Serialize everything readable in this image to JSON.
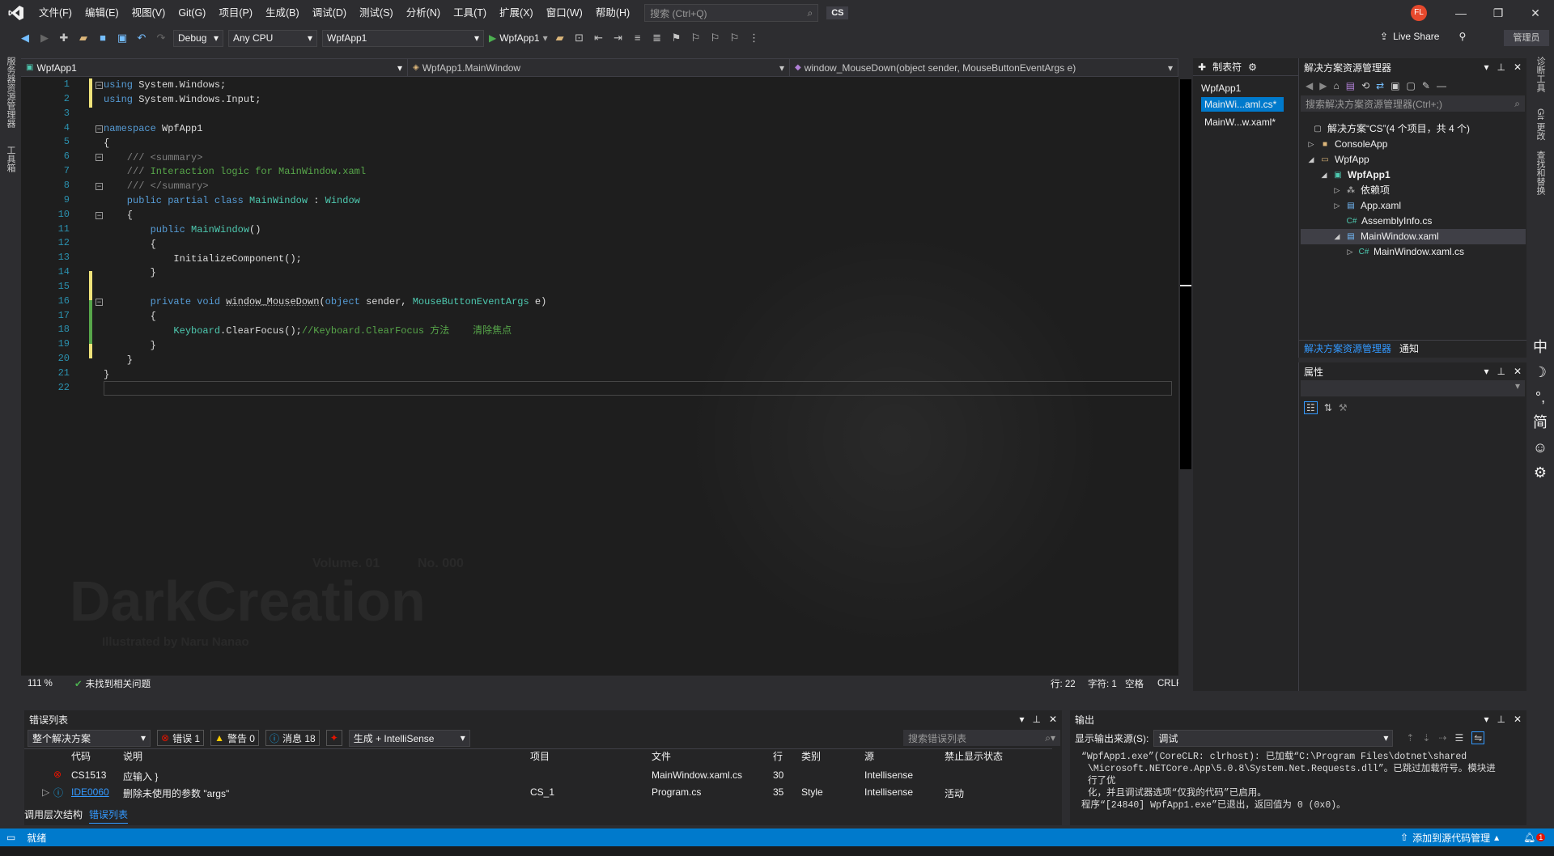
{
  "menu": {
    "items": [
      "文件(F)",
      "编辑(E)",
      "视图(V)",
      "Git(G)",
      "项目(P)",
      "生成(B)",
      "调试(D)",
      "测试(S)",
      "分析(N)",
      "工具(T)",
      "扩展(X)",
      "窗口(W)",
      "帮助(H)"
    ],
    "search_placeholder": "搜索 (Ctrl+Q)",
    "solution_badge": "CS",
    "avatar_initials": "FL"
  },
  "toolbar": {
    "config": "Debug",
    "platform": "Any CPU",
    "startup_project": "WpfApp1",
    "run_label": "WpfApp1",
    "live_share": "Live Share",
    "admin": "管理员"
  },
  "left_strip": {
    "tab1": "服务器资源管理器",
    "tab2": "工具箱"
  },
  "editor": {
    "nav_project": "WpfApp1",
    "nav_class": "WpfApp1.MainWindow",
    "nav_member": "window_MouseDown(object sender, MouseButtonEventArgs e)",
    "line_numbers": [
      "1",
      "2",
      "3",
      "4",
      "5",
      "6",
      "7",
      "8",
      "9",
      "10",
      "11",
      "12",
      "13",
      "14",
      "15",
      "16",
      "17",
      "18",
      "19",
      "20",
      "21",
      "22"
    ],
    "status": {
      "zoom": "111 %",
      "issues": "未找到相关问题",
      "line": "行: 22",
      "char": "字符: 1",
      "space": "空格",
      "eol": "CRLF"
    },
    "watermark": {
      "title": "DarkCreation",
      "volume": "Volume. 01",
      "number": "No. 000",
      "credit": "Illustrated by Naru Nanao"
    }
  },
  "tab_panel": {
    "title": "制表符",
    "group": "WpfApp1",
    "tabs": [
      "MainWi...aml.cs*",
      "MainW...w.xaml*"
    ]
  },
  "solution_explorer": {
    "title": "解决方案资源管理器",
    "search_placeholder": "搜索解决方案资源管理器(Ctrl+;)",
    "items": [
      {
        "label": "解决方案“CS”(4 个项目，共 4 个)",
        "icon": "solution-icon"
      },
      {
        "label": "ConsoleApp",
        "icon": "folder-icon"
      },
      {
        "label": "WpfApp",
        "icon": "folder-icon"
      },
      {
        "label": "WpfApp1",
        "icon": "csharp-project-icon"
      },
      {
        "label": "依赖项",
        "icon": "dependencies-icon"
      },
      {
        "label": "App.xaml",
        "icon": "xaml-icon"
      },
      {
        "label": "AssemblyInfo.cs",
        "icon": "csharp-file-icon"
      },
      {
        "label": "MainWindow.xaml",
        "icon": "xaml-icon"
      },
      {
        "label": "MainWindow.xaml.cs",
        "icon": "csharp-file-icon"
      }
    ],
    "tabs": [
      "解决方案资源管理器",
      "通知"
    ]
  },
  "properties": {
    "title": "属性"
  },
  "right_strip": {
    "tab1": "诊断工具",
    "tab2": "Git 更改",
    "tab3": "查找和替换",
    "ime": [
      "中",
      "☽",
      "°,",
      "简",
      "☺",
      "⚙"
    ]
  },
  "error_list": {
    "title": "错误列表",
    "scope": "整个解决方案",
    "errors": "错误 1",
    "warnings": "警告 0",
    "messages": "消息 18",
    "build_filter": "生成 + IntelliSense",
    "search_placeholder": "搜索错误列表",
    "columns": [
      "代码",
      "说明",
      "项目",
      "文件",
      "行",
      "类别",
      "源",
      "禁止显示状态"
    ],
    "rows": [
      {
        "code": "CS1513",
        "desc": "应输入 }",
        "project": "",
        "file": "MainWindow.xaml.cs",
        "line": "30",
        "category": "",
        "source": "Intellisense",
        "state": "",
        "kind": "error"
      },
      {
        "code": "IDE0060",
        "desc": "删除未使用的参数 \"args\"",
        "project": "CS_1",
        "file": "Program.cs",
        "line": "35",
        "category": "Style",
        "source": "Intellisense",
        "state": "活动",
        "kind": "info"
      }
    ]
  },
  "output": {
    "title": "输出",
    "source_label": "显示输出来源(S):",
    "source": "调试",
    "lines": [
      "“WpfApp1.exe”(CoreCLR: clrhost): 已加载“C:\\Program Files\\dotnet\\shared",
      "\\Microsoft.NETCore.App\\5.0.8\\System.Net.Requests.dll”。已跳过加载符号。模块进行了优",
      "化，并且调试器选项“仅我的代码”已启用。",
      "程序“[24840] WpfApp1.exe”已退出，返回值为 0 (0x0)。"
    ]
  },
  "bottom_tabs": [
    "调用层次结构",
    "错误列表"
  ],
  "statusbar": {
    "ready": "就绪",
    "source_control": "添加到源代码管理",
    "notifications": "1"
  },
  "colors": {
    "accent": "#007acc",
    "keyword": "#569cd6",
    "type": "#4ec9b0",
    "comment": "#57a64a",
    "linenum": "#2b91af"
  }
}
